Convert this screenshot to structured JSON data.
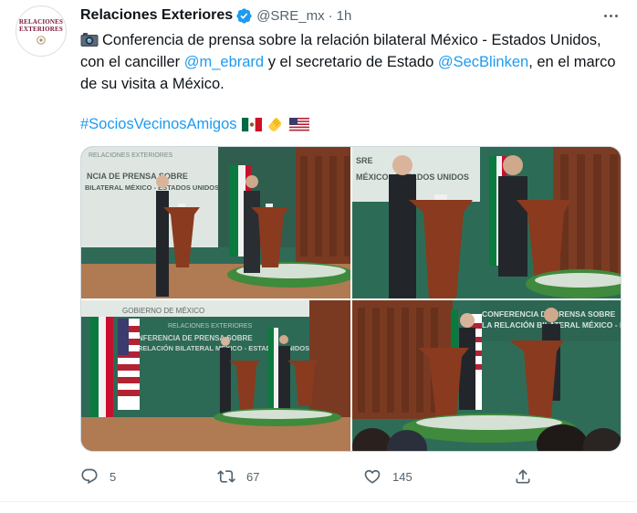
{
  "author": {
    "display_name": "Relaciones Exteriores",
    "handle": "@SRE_mx",
    "separator": "·",
    "time": "1h",
    "avatar_text": [
      "RELACIONES",
      "EXTERIORES"
    ]
  },
  "tweet": {
    "text_before": "Conferencia de prensa sobre la relación bilateral México - Estados Unidos, con el canciller ",
    "mention_1": "@m_ebrard",
    "text_middle": " y el secretario de Estado ",
    "mention_2": "@SecBlinken",
    "text_after": ", en el marco de su visita a México.",
    "hashtag": "#SociosVecinosAmigos"
  },
  "photos": [
    {
      "backdrop_lines": [
        "RELACIONES EXTERIORES",
        "NCIA DE PRENSA SOBRE",
        "BILATERAL MÉXICO - ESTADOS UNIDOS"
      ]
    },
    {
      "backdrop_lines": [
        "SRE",
        "MÉXICO - ESTADOS UNIDOS"
      ]
    },
    {
      "backdrop_lines": [
        "GOBIERNO DE MÉXICO",
        "RELACIONES EXTERIORES",
        "CONFERENCIA DE PRENSA SOBRE",
        "LA RELACIÓN BILATERAL MÉXICO - ESTADOS UNIDOS"
      ]
    },
    {
      "backdrop_lines": [
        "CONFERENCIA DE PRENSA SOBRE",
        "LA RELACIÓN BILATERAL MÉXICO - ESTA"
      ]
    }
  ],
  "actions": {
    "replies": "5",
    "retweets": "67",
    "likes": "145"
  },
  "colors": {
    "link": "#1d9bf0",
    "text": "#0f1419",
    "secondary": "#536471",
    "verified": "#1d9bf0"
  },
  "icons": [
    "camera-icon",
    "verified-badge-icon",
    "more-options-icon",
    "mexico-flag-icon",
    "clapping-hands-icon",
    "usa-flag-icon",
    "reply-icon",
    "retweet-icon",
    "like-icon",
    "share-icon"
  ]
}
